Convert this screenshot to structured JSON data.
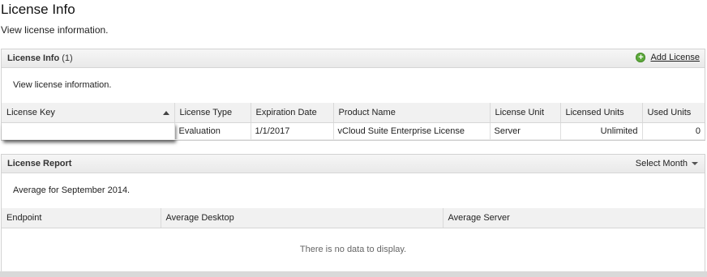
{
  "page": {
    "title": "License Info",
    "subtitle": "View license information."
  },
  "license_info": {
    "title": "License Info",
    "count": "(1)",
    "add_label": "Add License",
    "description": "View license information.",
    "columns": [
      "License Key",
      "License Type",
      "Expiration Date",
      "Product Name",
      "License Unit",
      "Licensed Units",
      "Used Units"
    ],
    "rows": [
      {
        "key": "",
        "type": "Evaluation",
        "expiration": "1/1/2017",
        "product": "vCloud Suite Enterprise License",
        "unit": "Server",
        "licensed": "Unlimited",
        "used": "0"
      }
    ]
  },
  "license_report": {
    "title": "License Report",
    "select_label": "Select Month",
    "description": "Average for September 2014.",
    "columns": [
      "Endpoint",
      "Average Desktop",
      "Average Server"
    ],
    "empty_text": "There is no data to display."
  },
  "colors": {
    "add_icon": "#5daa3c",
    "header_bg": "#f1f1f1",
    "border": "#d2d2d2"
  },
  "icons": {
    "add": "plus-circle-icon",
    "sort": "sort-ascending-icon",
    "dropdown": "chevron-down-icon"
  }
}
